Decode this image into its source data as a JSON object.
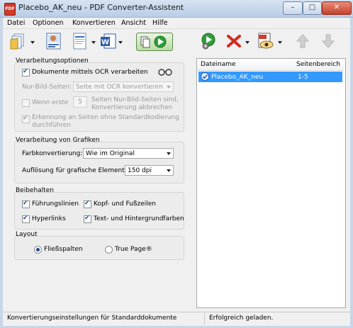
{
  "window": {
    "title": "Placebo_AK_neu - PDF Converter-Assistent",
    "app_icon_text": "PDF",
    "minimize_glyph": "–",
    "maximize_glyph": "□",
    "close_glyph": "✕"
  },
  "menu": [
    "Datei",
    "Optionen",
    "Konvertieren",
    "Ansicht",
    "Hilfe"
  ],
  "toolbar": {
    "left_icons": [
      "open-file-icon",
      "ocr-view-icon",
      "document-icon",
      "word-icon",
      "convert-icon"
    ],
    "right_icons": [
      "settings-run-icon",
      "remove-icon",
      "view-pdf-icon",
      "move-up-icon",
      "move-down-icon"
    ]
  },
  "processing": {
    "title": "Verarbeitungsoptionen",
    "ocr_label": "Dokumente mittels OCR verarbeiten",
    "ocr_checked": true,
    "image_pages_label": "Nur-Bild-Seiten:",
    "image_pages_value": "Seite mit OCR konvertieren",
    "first_label": "Wenn erste",
    "first_value": "5",
    "first_desc_1": "Seiten Nur-Bild-Seiten sind,",
    "first_desc_2": "Konvertierung abbrechen",
    "detect_label_1": "Erkennung an Seiten ohne Standardkodierung",
    "detect_label_2": "durchführen",
    "detect_checked": true
  },
  "graphics": {
    "title": "Verarbeitung von Grafiken",
    "color_label": "Farbkonvertierung:",
    "color_value": "Wie im Original",
    "resolution_label": "Auflösung für grafische Elemente:",
    "resolution_value": "150 dpi"
  },
  "retain": {
    "title": "Beibehalten",
    "items": [
      {
        "label": "Führungslinien",
        "checked": true
      },
      {
        "label": "Kopf- und Fußzeilen",
        "checked": true
      },
      {
        "label": "Hyperlinks",
        "checked": true
      },
      {
        "label": "Text- und Hintergrundfarben",
        "checked": true
      }
    ]
  },
  "layout": {
    "title": "Layout",
    "option_flow": "Fließspalten",
    "option_true_page": "True Page®",
    "selected": "Fließspalten"
  },
  "file_list": {
    "columns": [
      "Dateiname",
      "Seitenbereich"
    ],
    "rows": [
      {
        "name": "Placebo_AK_neu",
        "range": "1-5",
        "selected": true
      }
    ]
  },
  "status": {
    "left": "Konvertierungseinstellungen für Standarddokumente",
    "right": "Erfolgreich geladen."
  },
  "colors": {
    "selection": "#3399ff",
    "accent_blue": "#1d4a90",
    "go_green": "#2f9e3a"
  }
}
